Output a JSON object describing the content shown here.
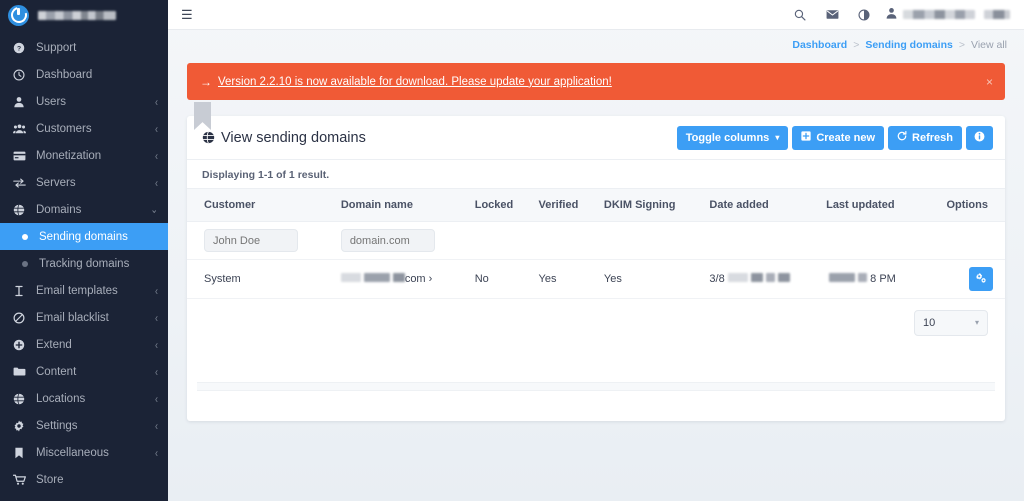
{
  "sidebar": {
    "brand_name_redacted": true,
    "items": [
      {
        "label": "Support",
        "icon": "question-circle-icon",
        "chevron": ""
      },
      {
        "label": "Dashboard",
        "icon": "clock-icon",
        "chevron": ""
      },
      {
        "label": "Users",
        "icon": "user-icon",
        "chevron": "‹"
      },
      {
        "label": "Customers",
        "icon": "users-icon",
        "chevron": "‹"
      },
      {
        "label": "Monetization",
        "icon": "credit-card-icon",
        "chevron": "‹"
      },
      {
        "label": "Servers",
        "icon": "exchange-icon",
        "chevron": "‹"
      },
      {
        "label": "Domains",
        "icon": "globe-icon",
        "chevron": "⌄"
      },
      {
        "label": "Sending domains",
        "icon": "dot-icon",
        "chevron": "",
        "active": true,
        "sub": true
      },
      {
        "label": "Tracking domains",
        "icon": "dot-icon",
        "chevron": "",
        "active": false,
        "sub": true
      },
      {
        "label": "Email templates",
        "icon": "text-cursor-icon",
        "chevron": "‹"
      },
      {
        "label": "Email blacklist",
        "icon": "ban-icon",
        "chevron": "‹"
      },
      {
        "label": "Extend",
        "icon": "plus-circle-icon",
        "chevron": "‹"
      },
      {
        "label": "Content",
        "icon": "folder-icon",
        "chevron": "‹"
      },
      {
        "label": "Locations",
        "icon": "globe-icon",
        "chevron": "‹"
      },
      {
        "label": "Settings",
        "icon": "gear-icon",
        "chevron": "‹"
      },
      {
        "label": "Miscellaneous",
        "icon": "bookmark-icon",
        "chevron": "‹"
      },
      {
        "label": "Store",
        "icon": "cart-icon",
        "chevron": ""
      }
    ]
  },
  "topbar": {
    "menu_icon": "hamburger-icon",
    "icons": [
      {
        "name": "search-icon",
        "glyph": "⌕"
      },
      {
        "name": "envelope-icon",
        "glyph": "✉"
      },
      {
        "name": "contrast-icon",
        "glyph": "◑"
      }
    ],
    "user_icon": "user-avatar-icon",
    "user_name_redacted": true
  },
  "breadcrumb": {
    "items": [
      {
        "label": "Dashboard",
        "link": true
      },
      {
        "label": "Sending domains",
        "link": true
      },
      {
        "label": "View all",
        "link": false
      }
    ],
    "separator": ">"
  },
  "alert": {
    "arrow": "→",
    "message": "Version 2.2.10 is now available for download. Please update your application!",
    "close_label": "×",
    "color": "#f05a36"
  },
  "card": {
    "title": "View sending domains",
    "title_icon": "globe-icon",
    "buttons": {
      "toggle_columns": "Toggle columns",
      "toggle_caret": "▾",
      "create_new": "Create new",
      "refresh": "Refresh",
      "info": "i"
    },
    "result_info": "Displaying 1-1 of 1 result.",
    "accent_color": "#3c9ef5"
  },
  "table": {
    "columns": [
      "Customer",
      "Domain name",
      "Locked",
      "Verified",
      "DKIM Signing",
      "Date added",
      "Last updated",
      "Options"
    ],
    "filters": {
      "customer_placeholder": "John Doe",
      "domain_placeholder": "domain.com"
    },
    "rows": [
      {
        "customer": "System",
        "domain_name_visible": "com",
        "domain_name_redacted": true,
        "domain_arrow": "›",
        "locked": "No",
        "verified": "Yes",
        "dkim_signing": "Yes",
        "date_added_visible": "3/8",
        "date_added_redacted": true,
        "last_updated_visible": "8 PM",
        "last_updated_redacted": true,
        "options_icon": "cogs-icon"
      }
    ]
  },
  "pagination": {
    "per_page_value": "10",
    "caret": "▾"
  }
}
